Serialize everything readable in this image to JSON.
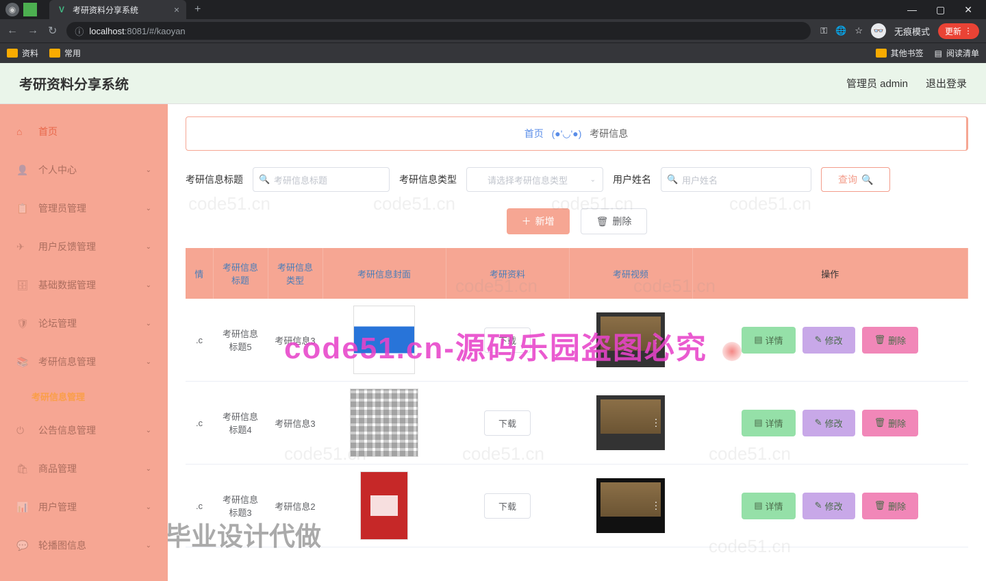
{
  "browser": {
    "tab_title": "考研资料分享系统",
    "url_prefix": "localhost",
    "url_port": ":8081",
    "url_path": "/#/kaoyan",
    "incognito_text": "无痕模式",
    "update_text": "更新",
    "bookmarks": {
      "b1": "资料",
      "b2": "常用",
      "other": "其他书签",
      "reading": "阅读清单"
    }
  },
  "header": {
    "app_title": "考研资料分享系统",
    "admin_label": "管理员 admin",
    "logout": "退出登录"
  },
  "sidebar": {
    "home": "首页",
    "personal": "个人中心",
    "admin_mgmt": "管理员管理",
    "feedback": "用户反馈管理",
    "base_data": "基础数据管理",
    "forum": "论坛管理",
    "kaoyan_mgmt": "考研信息管理",
    "kaoyan_sub": "考研信息管理",
    "notice": "公告信息管理",
    "goods": "商品管理",
    "user": "用户管理",
    "carousel": "轮播图信息"
  },
  "breadcrumb": {
    "home": "首页",
    "face": "(●'◡'●)",
    "current": "考研信息"
  },
  "search": {
    "title_label": "考研信息标题",
    "title_placeholder": "考研信息标题",
    "type_label": "考研信息类型",
    "type_placeholder": "请选择考研信息类型",
    "user_label": "用户姓名",
    "user_placeholder": "用户姓名",
    "query_btn": "查询"
  },
  "actions": {
    "add": "新增",
    "delete": "删除"
  },
  "table": {
    "headers": {
      "ext": "情",
      "title": "考研信息标题",
      "type": "考研信息类型",
      "cover": "考研信息封面",
      "resource": "考研资料",
      "video": "考研视频",
      "ops": "操作"
    },
    "download": "下载",
    "detail": "详情",
    "edit": "修改",
    "delete": "删除",
    "rows": [
      {
        "ext": ".c",
        "title": "考研信息标题5",
        "type": "考研信息3"
      },
      {
        "ext": ".c",
        "title": "考研信息标题4",
        "type": "考研信息3"
      },
      {
        "ext": ".c",
        "title": "考研信息标题3",
        "type": "考研信息2"
      }
    ]
  },
  "watermarks": {
    "main": "code51.cn-源码乐园盗图必究",
    "sub": "专业毕业设计代做",
    "bg": "code51.cn"
  }
}
